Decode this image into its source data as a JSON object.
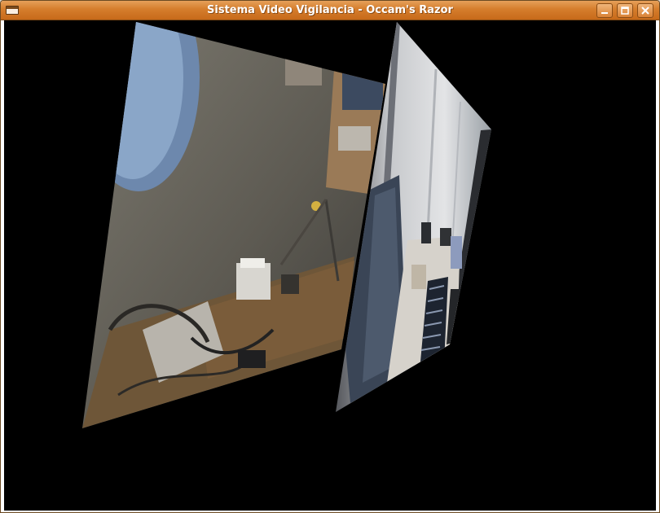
{
  "window": {
    "title": "Sistema Video Vigilancia - Occam's Razor",
    "icons": {
      "menu": "window-menu-icon",
      "minimize": "minimize-icon",
      "maximize": "maximize-icon",
      "close": "close-icon"
    },
    "colors": {
      "titlebar": "#d57d2c",
      "viewport_background": "#000000"
    }
  },
  "viewport": {
    "panels": [
      {
        "name": "camera-feed-left"
      },
      {
        "name": "camera-feed-right"
      }
    ]
  }
}
